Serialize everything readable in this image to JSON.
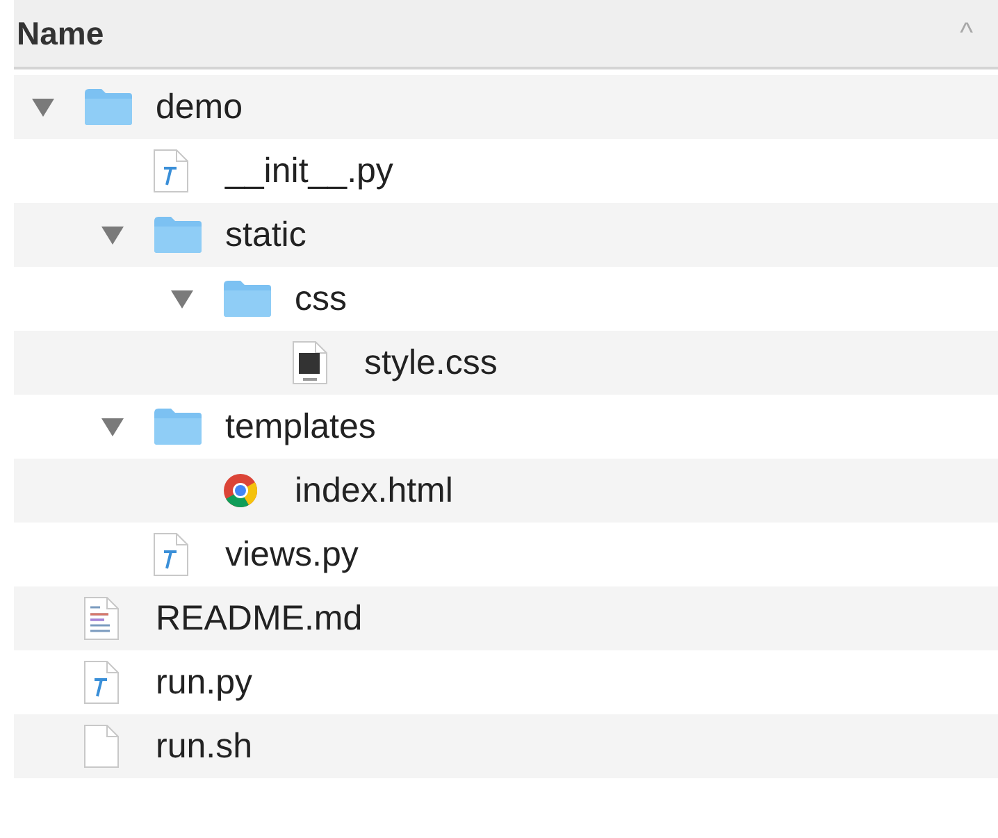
{
  "header": {
    "column": "Name",
    "sort_caret": "^"
  },
  "tree": [
    {
      "name": "demo",
      "kind": "folder",
      "expanded": true,
      "children": [
        {
          "name": "__init__.py",
          "kind": "python"
        },
        {
          "name": "static",
          "kind": "folder",
          "expanded": true,
          "children": [
            {
              "name": "css",
              "kind": "folder",
              "expanded": true,
              "children": [
                {
                  "name": "style.css",
                  "kind": "css"
                }
              ]
            }
          ]
        },
        {
          "name": "templates",
          "kind": "folder",
          "expanded": true,
          "children": [
            {
              "name": "index.html",
              "kind": "html"
            }
          ]
        },
        {
          "name": "views.py",
          "kind": "python"
        }
      ]
    },
    {
      "name": "README.md",
      "kind": "markdown"
    },
    {
      "name": "run.py",
      "kind": "python"
    },
    {
      "name": "run.sh",
      "kind": "plain"
    }
  ]
}
